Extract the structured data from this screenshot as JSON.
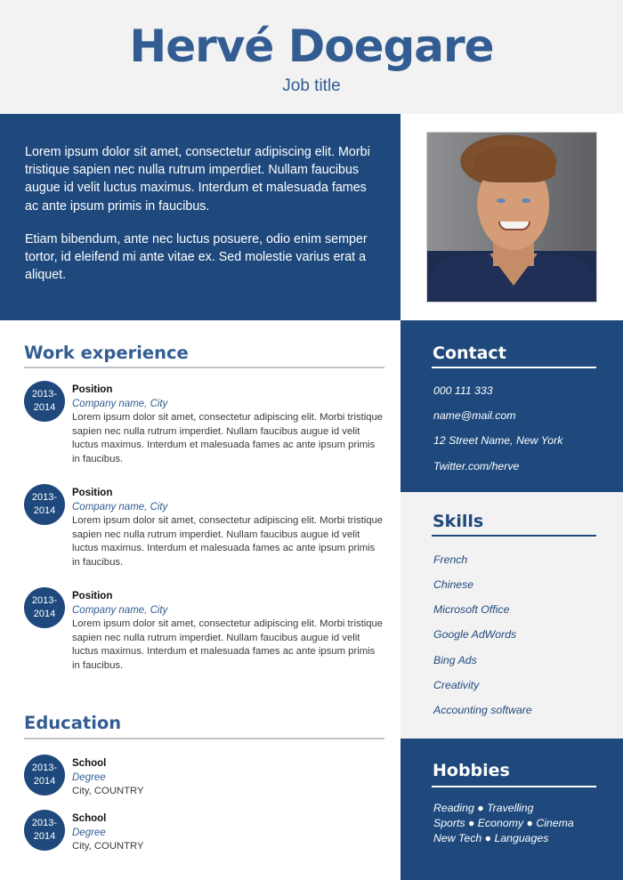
{
  "header": {
    "name": "Hervé Doegare",
    "job_title": "Job title"
  },
  "intro": {
    "paragraphs": [
      "Lorem ipsum dolor sit amet, consectetur adipiscing elit. Morbi tristique sapien nec nulla rutrum imperdiet. Nullam faucibus augue id velit luctus maximus. Interdum et malesuada fames ac ante ipsum primis in faucibus.",
      "Etiam bibendum, ante nec luctus posuere, odio enim semper tortor, id eleifend mi ante vitae ex. Sed molestie varius erat a aliquet."
    ]
  },
  "photo": {
    "alt": "profile-photo"
  },
  "work": {
    "title": "Work experience",
    "entries": [
      {
        "date_start": "2013-",
        "date_end": "2014",
        "position": "Position",
        "company": "Company name, City",
        "description": "Lorem ipsum dolor sit amet, consectetur adipiscing elit. Morbi tristique sapien nec nulla rutrum imperdiet. Nullam faucibus augue id velit luctus maximus. Interdum et malesuada fames ac ante ipsum primis in faucibus."
      },
      {
        "date_start": "2013-",
        "date_end": "2014",
        "position": "Position",
        "company": "Company name, City",
        "description": "Lorem ipsum dolor sit amet, consectetur adipiscing elit. Morbi tristique sapien nec nulla rutrum imperdiet. Nullam faucibus augue id velit luctus maximus. Interdum et malesuada fames ac ante ipsum primis in faucibus."
      },
      {
        "date_start": "2013-",
        "date_end": "2014",
        "position": "Position",
        "company": "Company name, City",
        "description": "Lorem ipsum dolor sit amet, consectetur adipiscing elit. Morbi tristique sapien nec nulla rutrum imperdiet. Nullam faucibus augue id velit luctus maximus. Interdum et malesuada fames ac ante ipsum primis in faucibus."
      }
    ]
  },
  "education": {
    "title": "Education",
    "entries": [
      {
        "date_start": "2013-",
        "date_end": "2014",
        "school": "School",
        "degree": "Degree",
        "location": "City, COUNTRY"
      },
      {
        "date_start": "2013-",
        "date_end": "2014",
        "school": "School",
        "degree": "Degree",
        "location": "City, COUNTRY"
      }
    ]
  },
  "contact": {
    "title": "Contact",
    "items": [
      "000 111 333",
      "name@mail.com",
      "12 Street Name, New York",
      "Twitter.com/herve"
    ]
  },
  "skills": {
    "title": "Skills",
    "items": [
      "French",
      "Chinese",
      "Microsoft Office",
      "Google AdWords",
      "Bing Ads",
      "Creativity",
      "Accounting software"
    ]
  },
  "hobbies": {
    "title": "Hobbies",
    "lines": [
      "Reading ● Travelling",
      "Sports ● Economy ● Cinema",
      "New Tech ● Languages"
    ]
  },
  "colors": {
    "primary": "#1f497d",
    "heading": "#335d92",
    "light_bg": "#f2f2f2"
  }
}
